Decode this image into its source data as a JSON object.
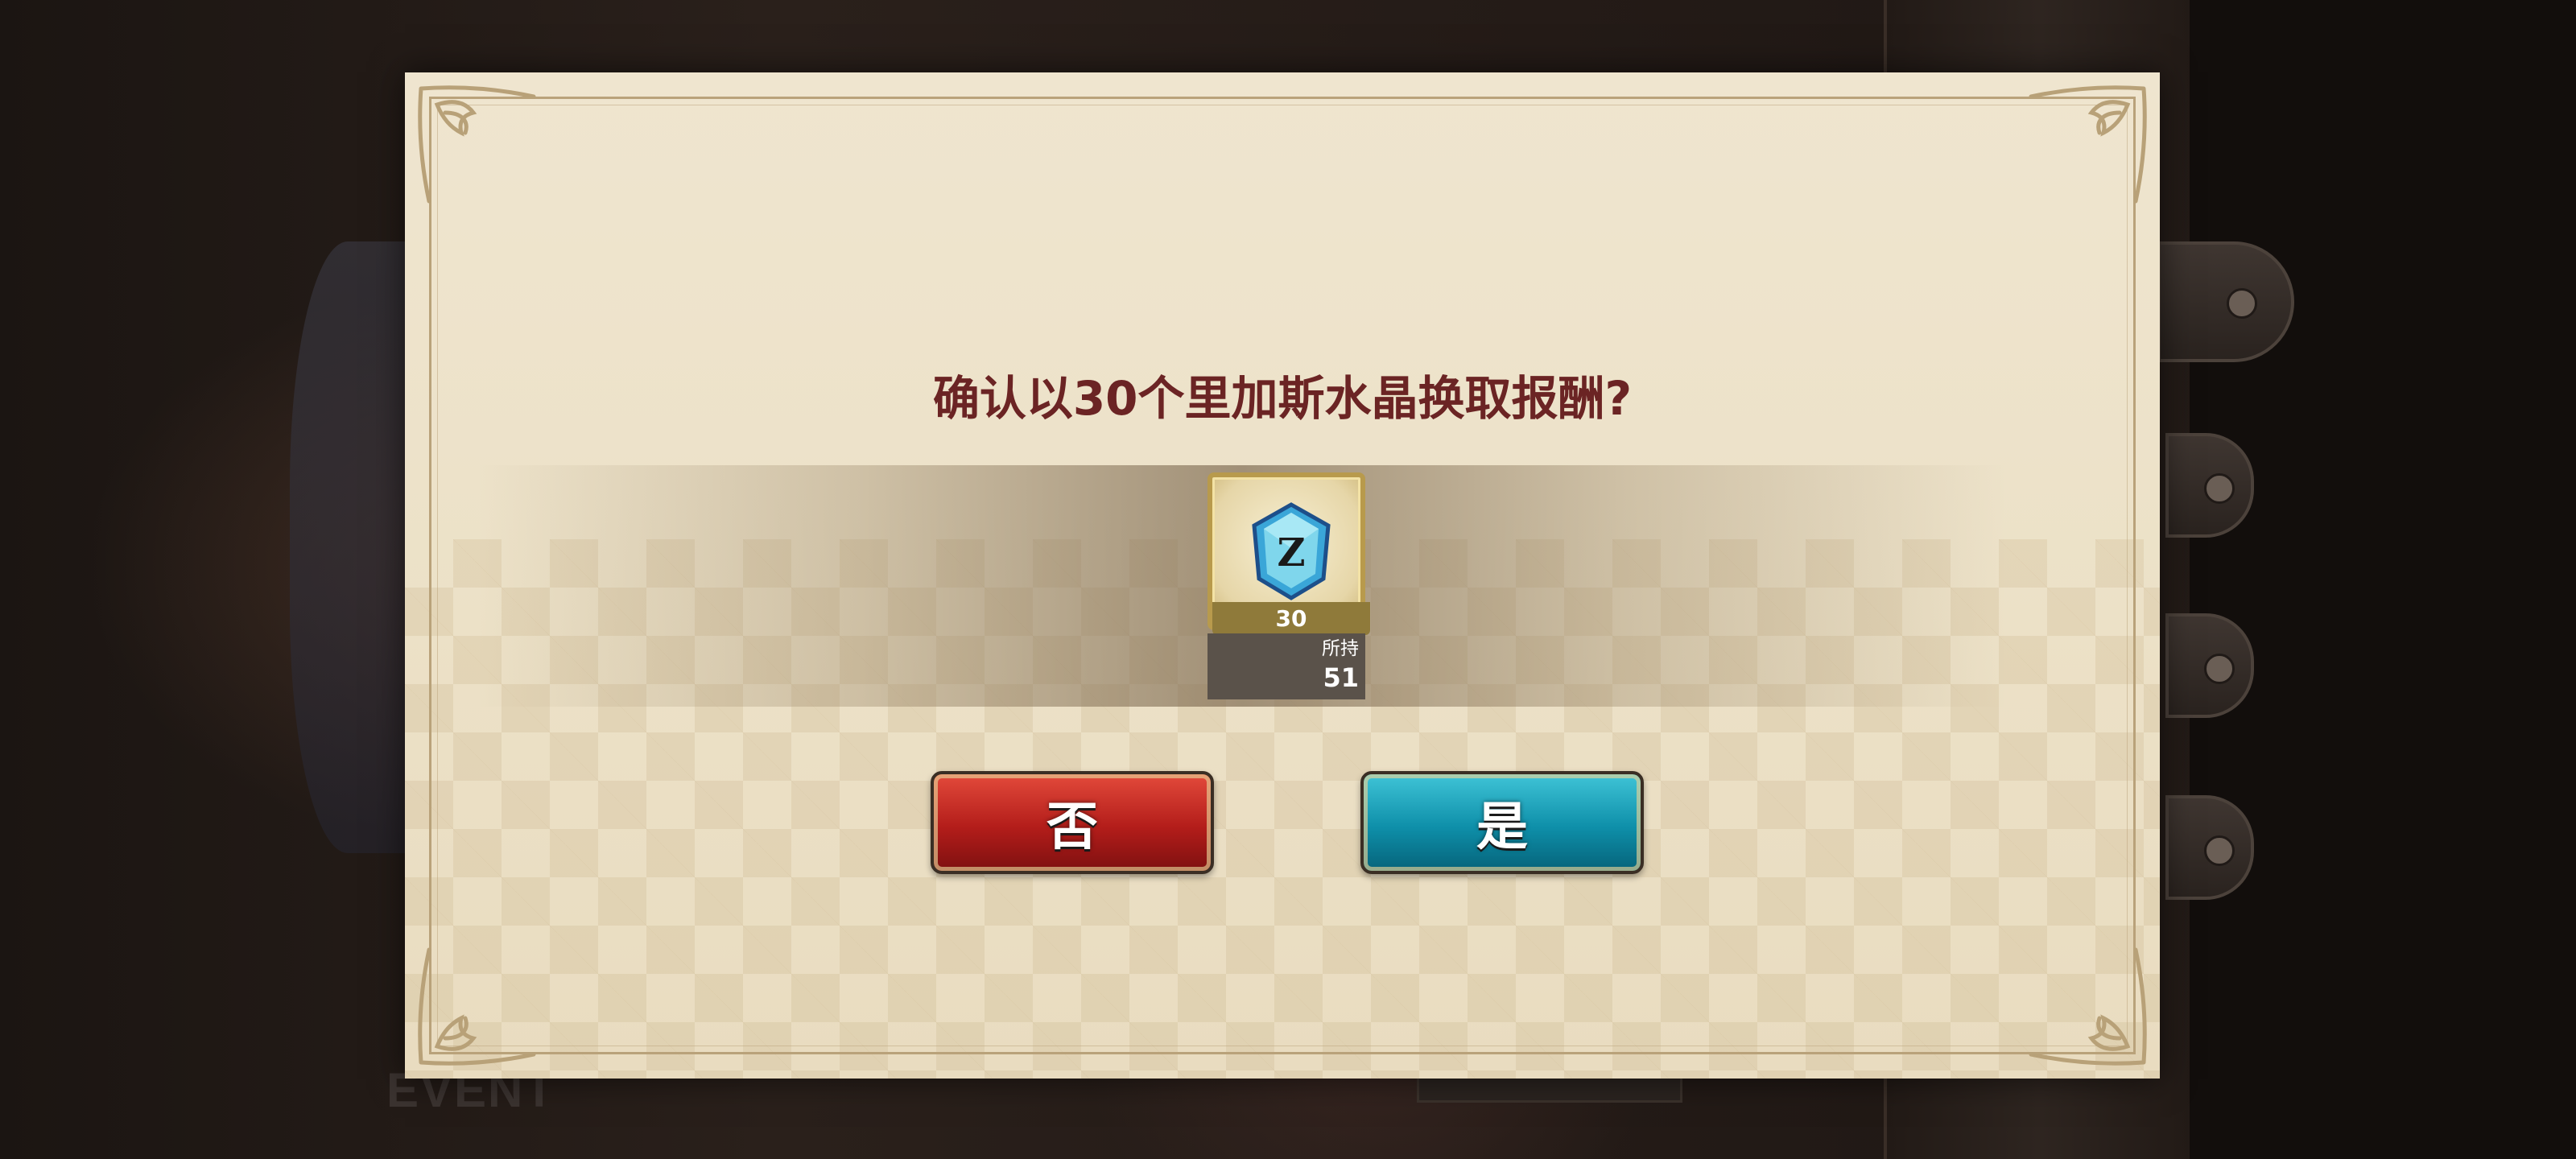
{
  "dialog": {
    "title": "确认以30个里加斯水晶换取报酬?",
    "item": {
      "icon": "blue-crystal-icon",
      "quantity": "30",
      "owned_label": "所持",
      "owned_count": "51"
    },
    "buttons": {
      "no_label": "否",
      "yes_label": "是"
    }
  },
  "background": {
    "event_label": "EVENT"
  },
  "colors": {
    "title": "#6b2424",
    "no_button": "#b31d1a",
    "yes_button": "#0e8fa9",
    "parchment": "#ece1c7"
  }
}
